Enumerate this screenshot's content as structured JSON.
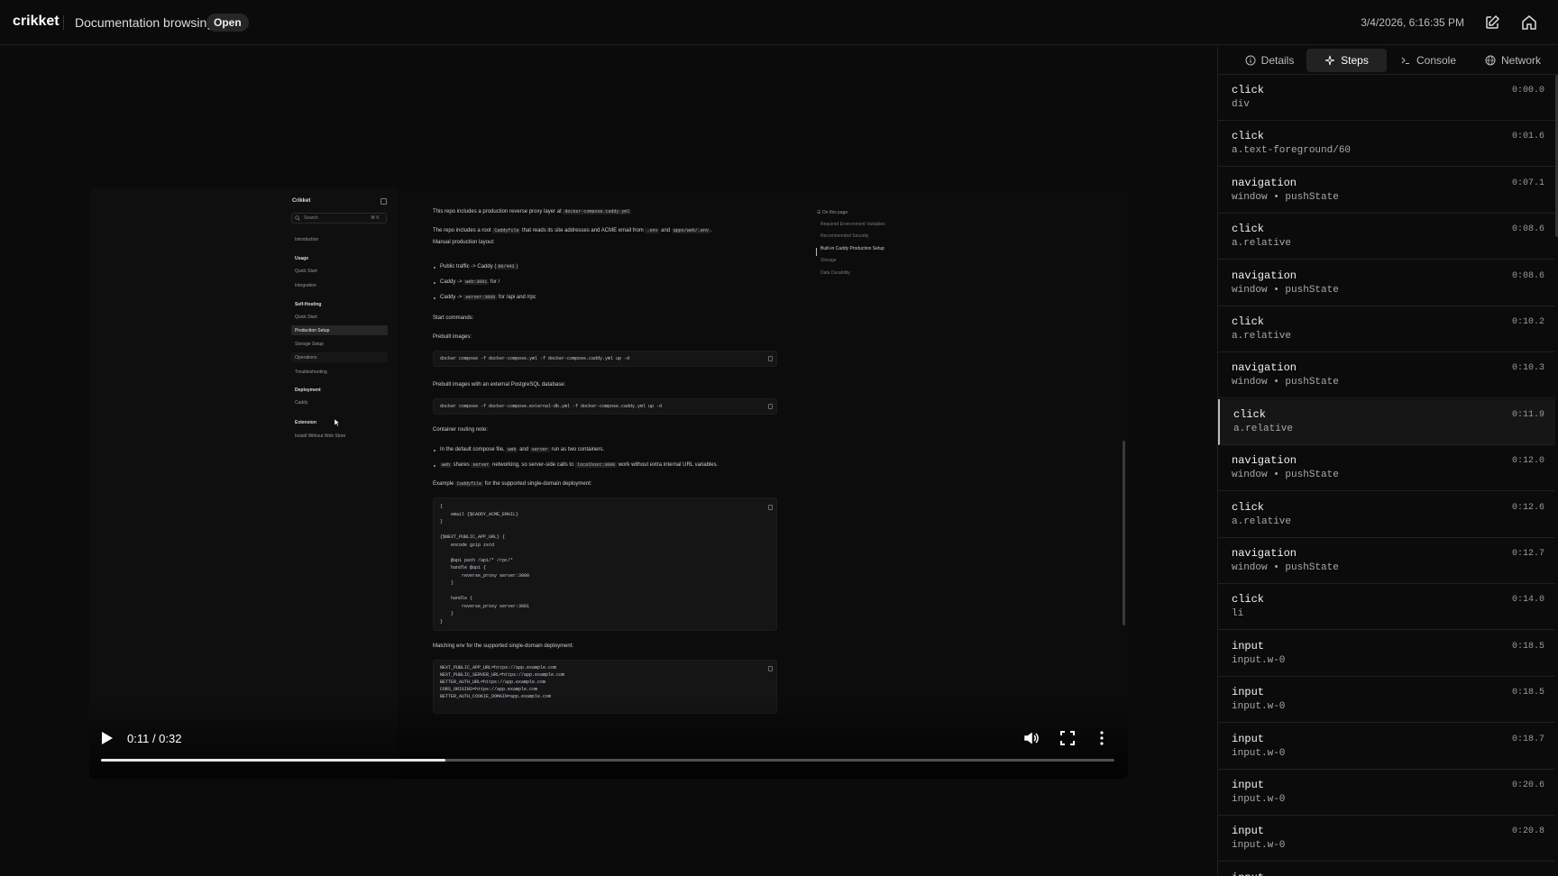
{
  "header": {
    "brand": "crikket",
    "session_title": "Documentation browsing",
    "status_badge": "Open",
    "timestamp": "3/4/2026, 6:16:35 PM"
  },
  "video": {
    "time_display": "0:11 / 0:32",
    "progress": 0.34,
    "frame": {
      "sidebar": {
        "title": "Crikket",
        "search_placeholder": "Search",
        "search_shortcut": "⌘ K",
        "items": [
          {
            "type": "item",
            "label": "Introduction"
          },
          {
            "type": "group",
            "label": "Usage"
          },
          {
            "type": "item",
            "label": "Quick Start"
          },
          {
            "type": "item",
            "label": "Integration"
          },
          {
            "type": "group",
            "label": "Self-Hosting"
          },
          {
            "type": "item",
            "label": "Quick Start"
          },
          {
            "type": "active",
            "label": "Production Setup"
          },
          {
            "type": "item",
            "label": "Storage Setup"
          },
          {
            "type": "hover",
            "label": "Operations"
          },
          {
            "type": "item",
            "label": "Troubleshooting"
          },
          {
            "type": "group",
            "label": "Deployment"
          },
          {
            "type": "item",
            "label": "Caddy"
          },
          {
            "type": "group",
            "label": "Extension"
          },
          {
            "type": "item",
            "label": "Install Without Web Store"
          }
        ]
      },
      "doc": {
        "p1_pre": "This repo includes a production reverse proxy layer at ",
        "p1_code": "docker-compose.caddy.yml",
        "p2_pre": "The repo includes a root ",
        "p2_code1": "Caddyfile",
        "p2_mid": " that reads its site addresses and ACME email from ",
        "p2_code2": ".env",
        "p2_and": " and ",
        "p2_code3": "apps/web/.env",
        "p2_end": ".",
        "layout_heading": "Manual production layout:",
        "bullets": [
          {
            "pre": "Public traffic -> Caddy (",
            "code": "80/443",
            "post": ")"
          },
          {
            "pre": "Caddy -> ",
            "code": "web:3001",
            "post": " for /"
          },
          {
            "pre": "Caddy -> ",
            "code": "server:3000",
            "post": " for /api and /rpc"
          }
        ],
        "start_heading": "Start commands:",
        "prebuilt_heading": "Prebuilt images:",
        "cmd1": "docker compose -f docker-compose.yml -f docker-compose.caddy.yml up -d",
        "prebuilt_ext_heading": "Prebuilt images with an external PostgreSQL database:",
        "cmd2": "docker compose -f docker-compose.external-db.yml -f docker-compose.caddy.yml up -d",
        "routing_heading": "Container routing note:",
        "routing_b1_pre": "In the default compose file, ",
        "routing_b1_code1": "web",
        "routing_b1_mid": " and ",
        "routing_b1_code2": "server",
        "routing_b1_post": " run as two containers.",
        "routing_b2_code1": "web",
        "routing_b2_mid1": " shares ",
        "routing_b2_code2": "server",
        "routing_b2_mid2": " networking, so server-side calls to ",
        "routing_b2_code3": "localhost:3000",
        "routing_b2_post": " work without extra internal URL variables.",
        "example_pre": "Example ",
        "example_code": "Caddyfile",
        "example_post": " for the supported single-domain deployment:",
        "caddyfile": "{\n    email {$CADDY_ACME_EMAIL}\n}\n\n{$NEXT_PUBLIC_APP_URL} {\n    encode gzip zstd\n\n    @api path /api/* /rpc/*\n    handle @api {\n        reverse_proxy server:3000\n    }\n\n    handle {\n        reverse_proxy server:3001\n    }\n}",
        "env_heading": "Matching env for the supported single-domain deployment:",
        "env": "NEXT_PUBLIC_APP_URL=https://app.example.com\nNEXT_PUBLIC_SERVER_URL=https://app.example.com\nBETTER_AUTH_URL=https://app.example.com\nCORS_ORIGINS=https://app.example.com\nBETTER_AUTH_COOKIE_DOMAIN=app.example.com"
      },
      "toc": {
        "heading": "On this page",
        "items": [
          {
            "label": "Required Environment Variables",
            "active": false
          },
          {
            "label": "Recommended Security",
            "active": false
          },
          {
            "label": "Built-in Caddy Production Setup",
            "active": true
          },
          {
            "label": "Storage",
            "active": false
          },
          {
            "label": "Data Durability",
            "active": false
          }
        ]
      }
    }
  },
  "panel": {
    "tabs": [
      {
        "label": "Details",
        "icon": "info-icon",
        "active": false
      },
      {
        "label": "Steps",
        "icon": "sparkle-icon",
        "active": true
      },
      {
        "label": "Console",
        "icon": "terminal-icon",
        "active": false
      },
      {
        "label": "Network",
        "icon": "globe-icon",
        "active": false
      }
    ],
    "steps": [
      {
        "action": "click",
        "target": "div",
        "time": "0:00.0",
        "active": false
      },
      {
        "action": "click",
        "target": "a.text-foreground/60",
        "time": "0:01.6",
        "active": false
      },
      {
        "action": "navigation",
        "target": "window • pushState",
        "time": "0:07.1",
        "active": false
      },
      {
        "action": "click",
        "target": "a.relative",
        "time": "0:08.6",
        "active": false
      },
      {
        "action": "navigation",
        "target": "window • pushState",
        "time": "0:08.6",
        "active": false
      },
      {
        "action": "click",
        "target": "a.relative",
        "time": "0:10.2",
        "active": false
      },
      {
        "action": "navigation",
        "target": "window • pushState",
        "time": "0:10.3",
        "active": false
      },
      {
        "action": "click",
        "target": "a.relative",
        "time": "0:11.9",
        "active": true
      },
      {
        "action": "navigation",
        "target": "window • pushState",
        "time": "0:12.0",
        "active": false
      },
      {
        "action": "click",
        "target": "a.relative",
        "time": "0:12.6",
        "active": false
      },
      {
        "action": "navigation",
        "target": "window • pushState",
        "time": "0:12.7",
        "active": false
      },
      {
        "action": "click",
        "target": "li",
        "time": "0:14.0",
        "active": false
      },
      {
        "action": "input",
        "target": "input.w-0",
        "time": "0:18.5",
        "active": false
      },
      {
        "action": "input",
        "target": "input.w-0",
        "time": "0:18.5",
        "active": false
      },
      {
        "action": "input",
        "target": "input.w-0",
        "time": "0:18.7",
        "active": false
      },
      {
        "action": "input",
        "target": "input.w-0",
        "time": "0:20.6",
        "active": false
      },
      {
        "action": "input",
        "target": "input.w-0",
        "time": "0:20.8",
        "active": false
      },
      {
        "action": "input",
        "target": "",
        "time": "",
        "active": false
      }
    ]
  }
}
